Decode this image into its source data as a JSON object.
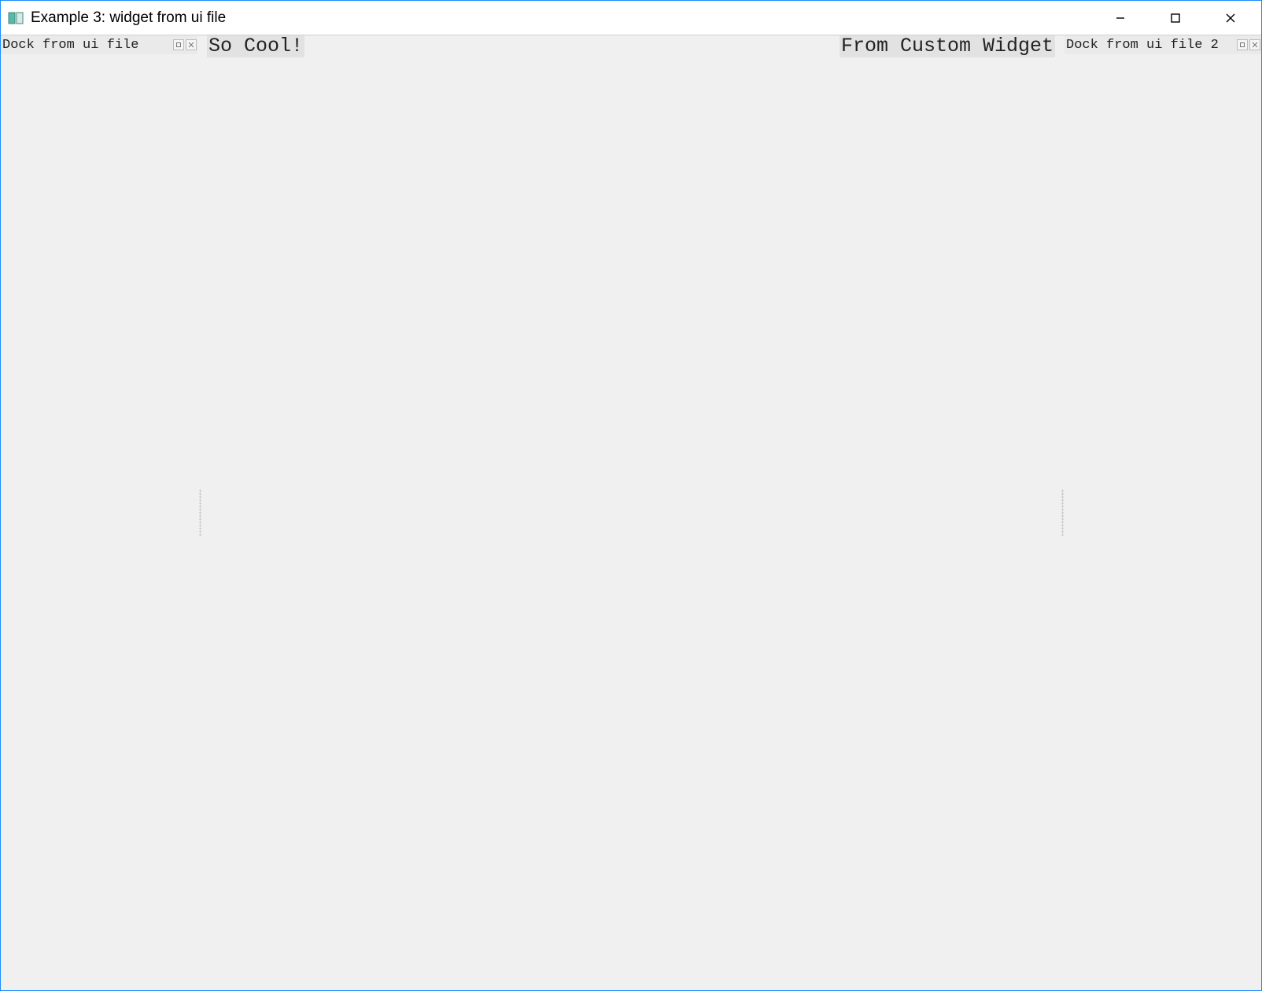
{
  "window": {
    "title": "Example 3: widget from ui file"
  },
  "dock_left": {
    "title": "Dock from ui file"
  },
  "dock_right": {
    "title": "Dock from ui file 2"
  },
  "central": {
    "label_left": "So Cool!",
    "label_right": "From Custom Widget"
  },
  "icons": {
    "app": "app-icon",
    "minimize": "minimize-icon",
    "maximize": "maximize-icon",
    "close": "close-icon",
    "dock_float": "float-icon",
    "dock_close": "close-icon"
  }
}
